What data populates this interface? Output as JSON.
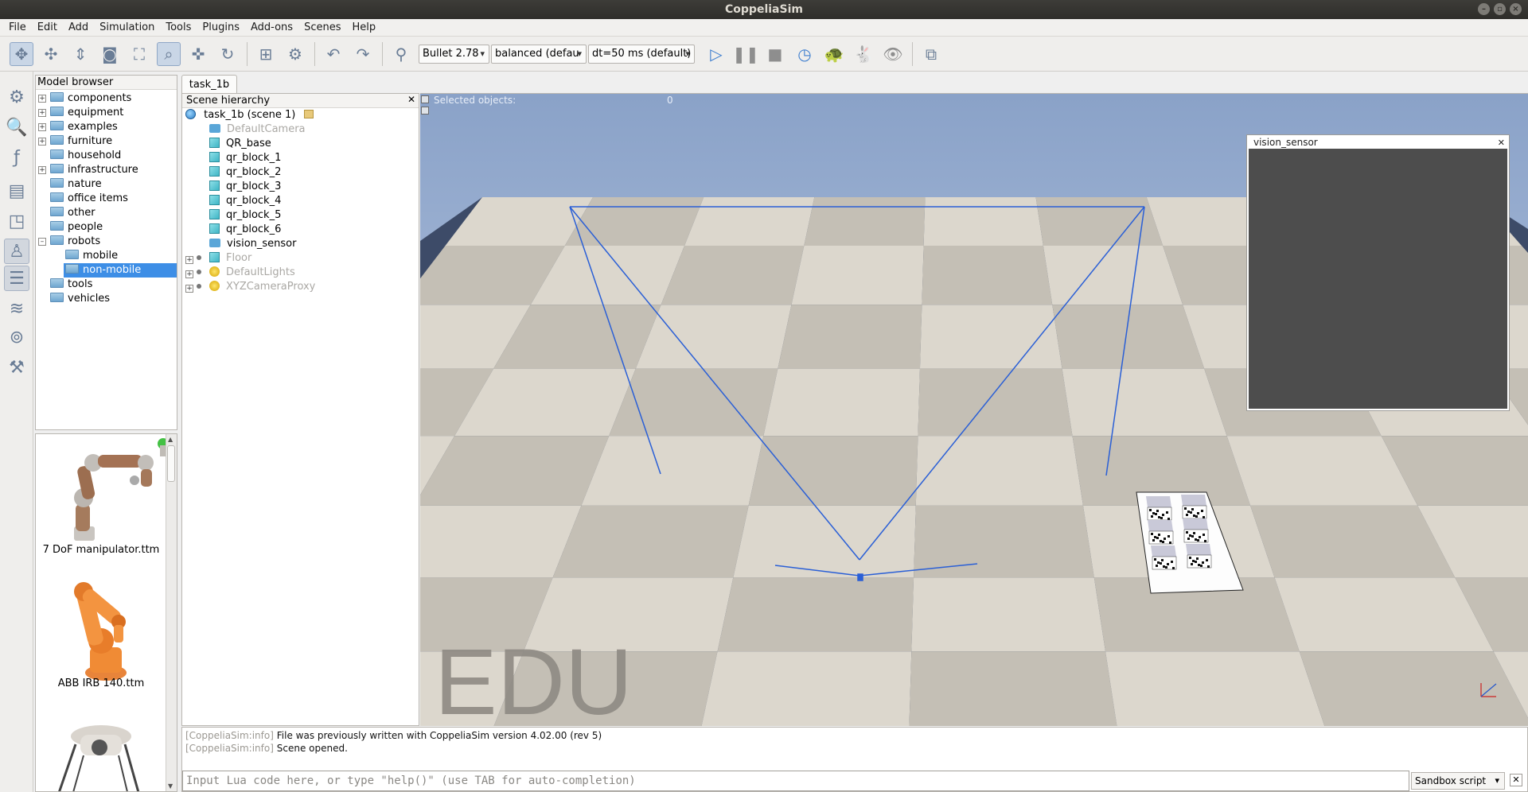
{
  "window": {
    "title": "CoppeliaSim"
  },
  "menu": [
    "File",
    "Edit",
    "Add",
    "Simulation",
    "Tools",
    "Plugins",
    "Add-ons",
    "Scenes",
    "Help"
  ],
  "toolbar": {
    "engine": "Bullet 2.78",
    "accuracy": "balanced (defau",
    "timestep": "dt=50 ms (default)",
    "icons": [
      "camera-pan-icon",
      "camera-rotate-icon",
      "camera-shift-icon",
      "camera-angle-icon",
      "fit-to-view-icon",
      "click-select-icon",
      "object-shift-icon",
      "object-rotate-icon",
      "assemble-icon",
      "transfer-dna-icon",
      "undo-icon",
      "redo-icon",
      "dynamics-icon",
      "start-simulation-icon",
      "pause-simulation-icon",
      "stop-simulation-icon",
      "realtime-icon",
      "slow-down-icon",
      "speed-up-icon",
      "visualization-icon",
      "page-selector-icon"
    ]
  },
  "model_browser": {
    "title": "Model browser",
    "items": [
      {
        "label": "components",
        "expandable": true
      },
      {
        "label": "equipment",
        "expandable": true
      },
      {
        "label": "examples",
        "expandable": true
      },
      {
        "label": "furniture",
        "expandable": true
      },
      {
        "label": "household",
        "expandable": false
      },
      {
        "label": "infrastructure",
        "expandable": true
      },
      {
        "label": "nature",
        "expandable": false
      },
      {
        "label": "office items",
        "expandable": false
      },
      {
        "label": "other",
        "expandable": false
      },
      {
        "label": "people",
        "expandable": false
      },
      {
        "label": "robots",
        "expandable": true,
        "expanded": true
      },
      {
        "label": "mobile",
        "child": true
      },
      {
        "label": "non-mobile",
        "child": true,
        "selected": true
      },
      {
        "label": "tools",
        "expandable": false
      },
      {
        "label": "vehicles",
        "expandable": false
      }
    ]
  },
  "thumbnails": [
    {
      "label": "7 DoF manipulator.ttm"
    },
    {
      "label": "ABB IRB 140.ttm"
    }
  ],
  "scene_tab": "task_1b",
  "hierarchy": {
    "title": "Scene hierarchy",
    "root": "task_1b (scene 1)",
    "items": [
      {
        "label": "DefaultCamera",
        "icon": "camera-icon",
        "dim": true
      },
      {
        "label": "QR_base",
        "icon": "shape-icon",
        "dim": false
      },
      {
        "label": "qr_block_1",
        "icon": "shape-icon",
        "dim": false
      },
      {
        "label": "qr_block_2",
        "icon": "shape-icon",
        "dim": false
      },
      {
        "label": "qr_block_3",
        "icon": "shape-icon",
        "dim": false
      },
      {
        "label": "qr_block_4",
        "icon": "shape-icon",
        "dim": false
      },
      {
        "label": "qr_block_5",
        "icon": "shape-icon",
        "dim": false
      },
      {
        "label": "qr_block_6",
        "icon": "shape-icon",
        "dim": false
      },
      {
        "label": "vision_sensor",
        "icon": "vision-sensor-icon",
        "dim": false
      },
      {
        "label": "Floor",
        "icon": "shape-icon",
        "dim": true,
        "expandable": true
      },
      {
        "label": "DefaultLights",
        "icon": "light-icon",
        "dim": true,
        "expandable": true
      },
      {
        "label": "XYZCameraProxy",
        "icon": "light-icon",
        "dim": true,
        "expandable": true
      }
    ]
  },
  "viewport": {
    "selected_label": "Selected objects:",
    "selected_count": "0",
    "watermark": "EDU",
    "floating_view_title": "vision_sensor"
  },
  "console": {
    "lines": [
      {
        "tag": "[CoppeliaSim:info]",
        "text": "File was previously written with CoppeliaSim version 4.02.00 (rev 5)"
      },
      {
        "tag": "[CoppeliaSim:info]",
        "text": "Scene opened."
      }
    ],
    "input_placeholder": "Input Lua code here, or type \"help()\" (use TAB for auto-completion)",
    "script_mode": "Sandbox script"
  },
  "colors": {
    "selection": "#3d8ee6",
    "floor_light": "#dcd7cd",
    "floor_dark": "#c4bfb5",
    "sky_top": "#8aa2c8",
    "sensor_lines": "#2a5fd6",
    "vision_bg": "#4d4d4d"
  }
}
